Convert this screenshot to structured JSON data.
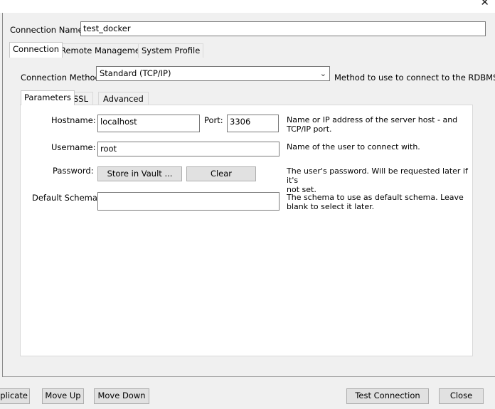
{
  "window": {
    "close_glyph": "✕"
  },
  "connection_name": {
    "label": "Connection Name:",
    "value": "test_docker"
  },
  "tabs": [
    {
      "label": "Connection"
    },
    {
      "label": "Remote Management"
    },
    {
      "label": "System Profile"
    }
  ],
  "connection_method": {
    "label": "Connection Method:",
    "value": "Standard (TCP/IP)",
    "help": "Method to use to connect to the RDBMS"
  },
  "subtabs": [
    {
      "label": "Parameters"
    },
    {
      "label": "SSL"
    },
    {
      "label": "Advanced"
    }
  ],
  "params": {
    "hostname": {
      "label": "Hostname:",
      "value": "localhost"
    },
    "port": {
      "label": "Port:",
      "value": "3306"
    },
    "host_help": [
      "Name or IP address of the server host - and",
      "TCP/IP port."
    ],
    "username": {
      "label": "Username:",
      "value": "root",
      "help": "Name of the user to connect with."
    },
    "password": {
      "label": "Password:",
      "store_label": "Store in Vault ...",
      "clear_label": "Clear",
      "help": [
        "The user's password. Will be requested later if it's",
        "not set."
      ]
    },
    "schema": {
      "label": "Default Schema:",
      "value": "",
      "help": [
        "The schema to use as default schema. Leave",
        "blank to select it later."
      ]
    }
  },
  "footer": {
    "duplicate_label": "uplicate",
    "move_up_label": "Move Up",
    "move_down_label": "Move Down",
    "test_label": "Test Connection",
    "close_label": "Close"
  },
  "colors": {
    "window_bg": "#f0f0f0",
    "pane_bg": "#ffffff",
    "button_bg": "#e1e1e1",
    "border": "#7a7a7a"
  },
  "icons": {
    "dropdown": "chevron-down-icon",
    "close": "close-icon"
  }
}
